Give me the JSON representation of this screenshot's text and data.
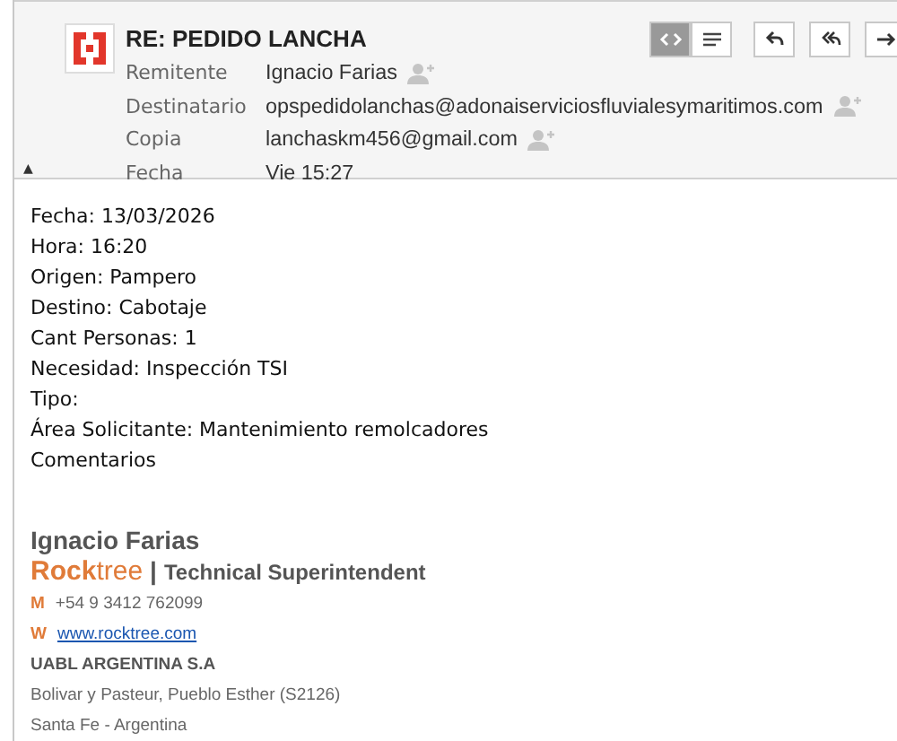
{
  "header": {
    "subject": "RE: PEDIDO LANCHA",
    "view_toggle": [
      {
        "kind": "html",
        "selected": true
      },
      {
        "kind": "text",
        "selected": false
      }
    ],
    "actions": [
      {
        "kind": "reply"
      },
      {
        "kind": "reply_all"
      },
      {
        "kind": "forward"
      }
    ],
    "fields": [
      {
        "label": "Remitente",
        "value": "Ignacio Farias",
        "addable": true
      },
      {
        "label": "Destinatario",
        "value": "opspedidolanchas@adonaiserviciosfluvialesymaritimos.com",
        "addable": true
      },
      {
        "label": "Copia",
        "value": "lanchaskm456@gmail.com",
        "addable": true
      },
      {
        "label": "Fecha",
        "value": "Vie 15:27",
        "addable": false
      }
    ],
    "collapse": "▲"
  },
  "body": [
    "Fecha: 13/03/2026",
    "Hora: 16:20",
    "Origen: Pampero",
    "Destino: Cabotaje",
    "Cant Personas: 1",
    "Necesidad: Inspección TSI",
    "Tipo:",
    "Área Solicitante: Mantenimiento remolcadores",
    "Comentarios"
  ],
  "signature": {
    "name": "Ignacio Farias",
    "brand_bold": "Rock",
    "brand_rest": "tree",
    "separator": "|",
    "role": "Technical Superintendent",
    "contacts": [
      {
        "label": "M",
        "value": "+54 9 3412 762099",
        "kind": "text"
      },
      {
        "label": "W",
        "value": "www.rocktree.com",
        "kind": "link"
      }
    ],
    "company": "UABL ARGENTINA S.A",
    "address": [
      "Bolivar y Pasteur, Pueblo Esther (S2126)",
      "Santa Fe - Argentina"
    ]
  }
}
